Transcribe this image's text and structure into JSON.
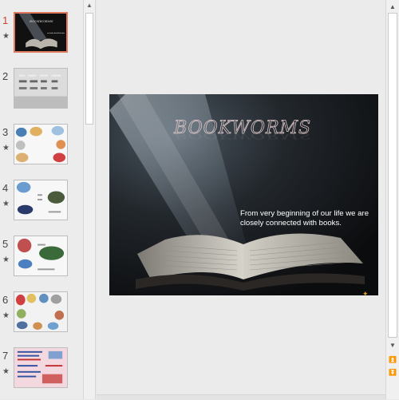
{
  "thumbnails": [
    {
      "number": "1",
      "selected": true
    },
    {
      "number": "2",
      "selected": false
    },
    {
      "number": "3",
      "selected": false
    },
    {
      "number": "4",
      "selected": false
    },
    {
      "number": "5",
      "selected": false
    },
    {
      "number": "6",
      "selected": false
    },
    {
      "number": "7",
      "selected": false
    }
  ],
  "slide": {
    "title": "BOOKWORMS",
    "subtitle": "From very beginning of our life we are closely connected with books."
  },
  "thumb_text": {
    "t1_title": "BOOKWORMS",
    "t1_sub": "From very beginning of our life we are closely connected with books."
  },
  "icons": {
    "star": "★",
    "scroll_up": "▲",
    "scroll_down": "▼",
    "prev_slide": "⏫",
    "next_slide": "⏬",
    "corner": "✦"
  },
  "colors": {
    "active_number": "#c8442c",
    "selected_border": "#e07a5f"
  }
}
